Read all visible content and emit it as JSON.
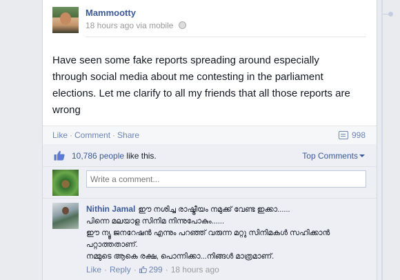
{
  "post": {
    "author": "Mammootty",
    "time": "18 hours ago",
    "via": "via mobile",
    "text": "Have seen some fake reports spreading around especially through social media about me contesting in the parliament elections. Let me clarify to all my friends that all those reports are wrong"
  },
  "actions": {
    "like": "Like",
    "comment": "Comment",
    "share": "Share",
    "share_count": "998"
  },
  "likes": {
    "count_text": "10,786 people",
    "suffix": " like this.",
    "top_comments": "Top Comments"
  },
  "composer": {
    "placeholder": "Write a comment..."
  },
  "comment": {
    "author": "Nithin Jamal",
    "lines": [
      "ഈ നശിച്ച രാഷ്ട്രീയം നമുക്ക് വേണ്ട ഇക്കാ......",
      "പിന്നെ മലയാള സിനിമ നിന്നുപോകും......",
      "ഈ ന്യൂ ജനറേഷൻ എന്നും പറഞ്ഞ് വരുന്ന മറ്റു സിനിമകൾ സഹിക്കാൻ",
      "പറ്റാത്തതാണ്.",
      "നമ്മുടെ ആകെ രക്ഷ, പൊന്നിക്കാ...നിങ്ങൾ മാത്രമാണ്."
    ],
    "like": "Like",
    "reply": "Reply",
    "likes": "299",
    "time": "18 hours ago"
  },
  "icons": {
    "globe": "globe-icon",
    "share": "share-count-icon",
    "thumb": "thumbs-up-icon"
  },
  "colors": {
    "link": "#3b5998",
    "muted_link": "#6d84b4",
    "ufi_background": "#edeff4"
  }
}
